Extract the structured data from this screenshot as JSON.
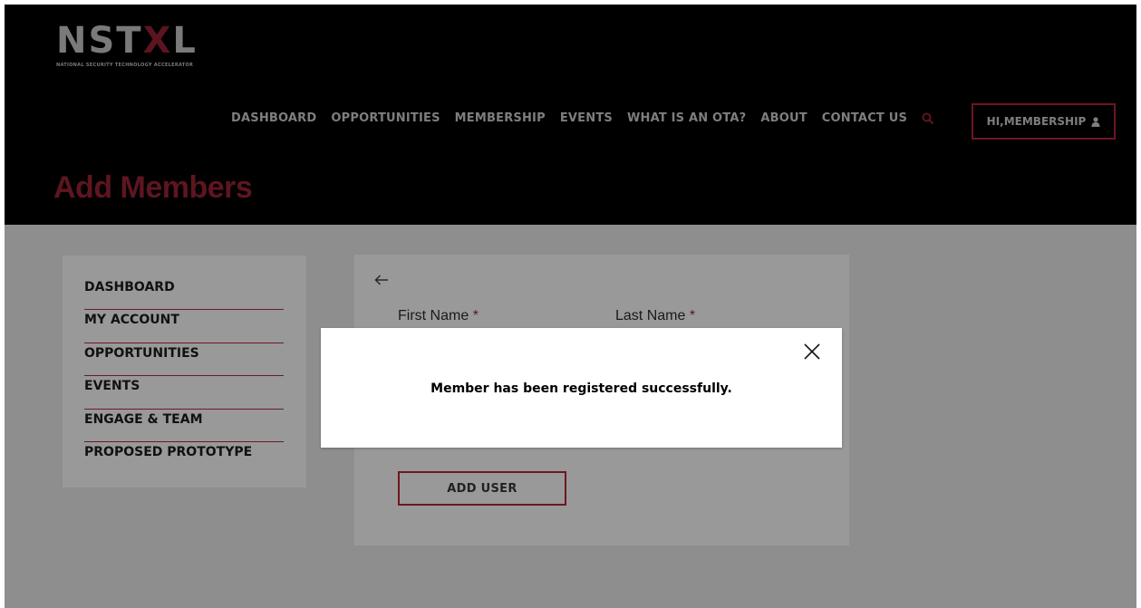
{
  "brand": {
    "name_prefix": "NST",
    "name_x": "X",
    "name_suffix": "L",
    "tagline": "NATIONAL SECURITY TECHNOLOGY ACCELERATOR"
  },
  "nav": {
    "items": [
      "DASHBOARD",
      "OPPORTUNITIES",
      "MEMBERSHIP",
      "EVENTS",
      "WHAT IS AN OTA?",
      "ABOUT",
      "CONTACT US"
    ],
    "search_icon": "search-icon",
    "user_button_label": "HI,MEMBERSHIP",
    "user_icon": "user-icon"
  },
  "page": {
    "title": "Add Members"
  },
  "sidebar": {
    "items": [
      "DASHBOARD",
      "MY ACCOUNT",
      "OPPORTUNITIES",
      "EVENTS",
      "ENGAGE & TEAM",
      "PROPOSED PROTOTYPE"
    ]
  },
  "form": {
    "back_icon": "arrow-left-icon",
    "first_name_label": "First Name",
    "last_name_label": "Last Name",
    "required_marker": "*",
    "add_user_label": "ADD USER"
  },
  "modal": {
    "message": "Member has been registered successfully.",
    "close_icon": "close-icon"
  },
  "colors": {
    "accent": "#6f1620",
    "header_bg": "#000000",
    "overlay_bg": "#8e8e8e",
    "modal_bg": "#ffffff"
  }
}
